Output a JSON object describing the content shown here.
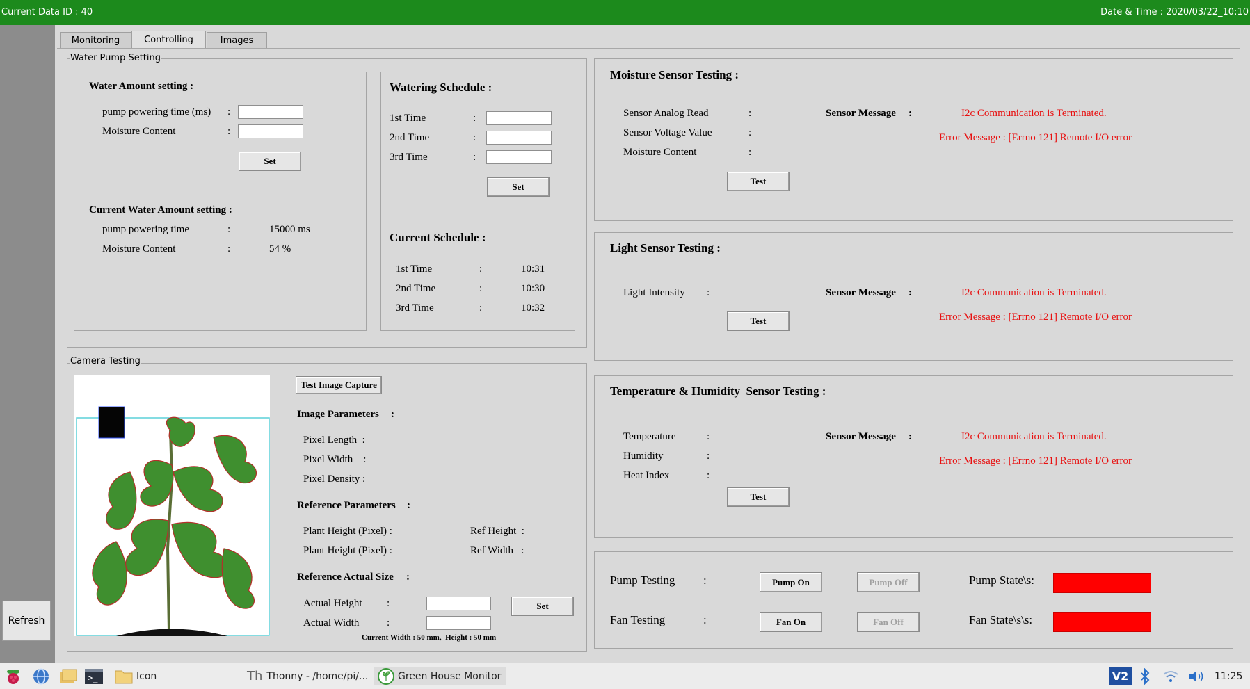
{
  "titlebar": {
    "data_id": "Current Data ID : 40",
    "datetime": "Date & Time : 2020/03/22_10:10"
  },
  "sidebar": {
    "refresh_label": "Refresh"
  },
  "tabs": [
    {
      "label": "Monitoring"
    },
    {
      "label": "Controlling"
    },
    {
      "label": "Images"
    }
  ],
  "pump_setting": {
    "group_title": "Water Pump Setting",
    "water": {
      "title": "Water Amount setting :",
      "pump_time_label": "pump powering time (ms)",
      "moisture_label": "Moisture Content",
      "colon": ":",
      "set_label": "Set",
      "current_title": "Current Water Amount setting :",
      "cur_pump_label": "pump powering time",
      "cur_pump_value": "15000 ms",
      "cur_moisture_label": "Moisture Content",
      "cur_moisture_value": "54 %"
    },
    "schedule": {
      "title": "Watering Schedule :",
      "t1": "1st Time",
      "t2": "2nd Time",
      "t3": "3rd Time",
      "colon": ":",
      "set_label": "Set",
      "current_title": "Current Schedule :",
      "v1": "10:31",
      "v2": "10:30",
      "v3": "10:32"
    }
  },
  "camera": {
    "group_title": "Camera Testing",
    "capture_label": "Test Image Capture",
    "image_params": "Image Parameters",
    "colon": ":",
    "pixel_length": "Pixel Length  :",
    "pixel_width": "Pixel Width    :",
    "pixel_density": "Pixel Density :",
    "ref_params": "Reference Parameters",
    "plant_height_1": "Plant Height (Pixel) :",
    "plant_height_2": "Plant Height (Pixel) :",
    "ref_height": "Ref Height  :",
    "ref_width": "Ref Width   :",
    "ref_actual": "Reference Actual Size",
    "actual_height": "Actual Height",
    "actual_width": "Actual Width",
    "set_label": "Set",
    "current_size": "Current Width : 50 mm,  Height : 50 mm"
  },
  "moisture": {
    "title": "Moisture Sensor Testing :",
    "analog": "Sensor Analog Read",
    "voltage": "Sensor Voltage Value",
    "content": "Moisture Content",
    "colon": ":",
    "msg_label": "Sensor Message",
    "msg1": "I2c Communication is Terminated.",
    "msg2": "Error Message : [Errno 121] Remote I/O error",
    "test_label": "Test"
  },
  "light": {
    "title": "Light Sensor Testing :",
    "intensity": "Light Intensity",
    "colon": ":",
    "msg_label": "Sensor Message",
    "msg1": "I2c Communication is Terminated.",
    "msg2": "Error Message : [Errno 121] Remote I/O error",
    "test_label": "Test"
  },
  "temp": {
    "title": "Temperature & Humidity  Sensor Testing :",
    "temperature": "Temperature",
    "humidity": "Humidity",
    "heat_index": "Heat Index",
    "colon": ":",
    "msg_label": "Sensor Message",
    "msg1": "I2c Communication is Terminated.",
    "msg2": "Error Message : [Errno 121] Remote I/O error",
    "test_label": "Test"
  },
  "actuators": {
    "pump_label": "Pump Testing",
    "fan_label": "Fan Testing",
    "colon": ":",
    "pump_on": "Pump On",
    "pump_off": "Pump Off",
    "fan_on": "Fan On",
    "fan_off": "Fan Off",
    "pump_state": "Pump State\\s:",
    "fan_state": "Fan State\\s\\s:",
    "pump_state_color": "#ff0000",
    "fan_state_color": "#ff0000"
  },
  "taskbar": {
    "folder_label": "Icon",
    "thonny_label": "Thonny  -  /home/pi/...",
    "app_label": "Green House Monitor",
    "clock": "11:25"
  }
}
